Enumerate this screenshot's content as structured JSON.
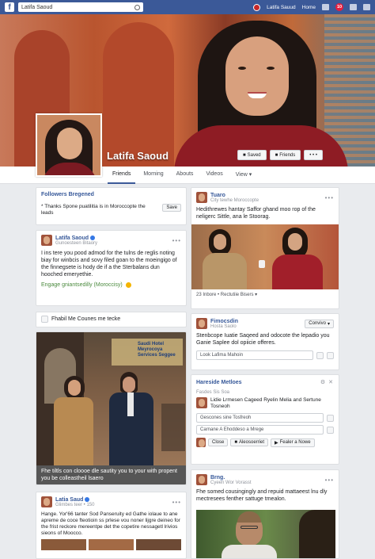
{
  "topbar": {
    "search_text": "Latifa Saoud",
    "user_name": "Latifa Sauud",
    "home_label": "Home",
    "notif_count": "10"
  },
  "profile": {
    "name": "Latifa Saoud",
    "cover_buttons": [
      "Saved",
      "Friends",
      "• • •"
    ]
  },
  "tabs": [
    "Friends",
    "Morning",
    "Abouts",
    "Videos",
    "View ▾"
  ],
  "left": {
    "followers_card": {
      "title": "Followers Bregened",
      "text": "* Thanks Spone puatilitia is in Moroccopte the leads",
      "button": "Save"
    },
    "post1": {
      "author": "Latifa Saoud",
      "meta": "Gunoesteen Bitaory",
      "body": "I ins tere you pood admod for the tulns de reglis noting biay for winbcis and sovy filed goan to the moeingigo of the finnegsete is hody de if a the Sterbalans dun hooched emeryethie.",
      "footer": "Engage gniantsedilly (Moroccisy)"
    },
    "strip": {
      "text": "Fhabil Me Counes me tecke"
    },
    "photo_post": {
      "sign_text": "Saudi Hotel\nMeyrocoya\nServices Seggee",
      "caption": "Fhe tiltls con cloooe dle sautity you to your with propent you be colleastheil lsaero"
    },
    "post2": {
      "author": "Latia Saud",
      "meta": "Glimbes teer • 150",
      "body": "Hange. Yor'66 tanter Sod Panseruity ed Gathe iolaue to ane apreme de coce fteotioin ss prlese vou noner lijgre deineo for the frist reckore mereentpe det the copetire nessagetl lrivios sieons of Moocco."
    }
  },
  "right": {
    "post1": {
      "author": "Tuaro",
      "meta": "City tewhe Moroccopte",
      "body": "Hedithrewes hantay Saffor ghand moo rop of the neligerc Sittle, ana le Stoorag.",
      "stats": "23 Inbore • Rectutiie Bisers ▾"
    },
    "post2": {
      "author": "Fimocsdin",
      "meta": "Hosta Saolo",
      "follow_btn": "Convivo",
      "body": "Stenbcope Iuatie Saqeed and odocote the lepadio you Ganie Saplee dol opiicie offeres.",
      "input": "Look Lafima Mahoin"
    },
    "groups": {
      "title": "Hareside Metloes",
      "sub": "Fasdes Sis Soa",
      "item_text": "Lidie Lrmesen Cageed Ryelin Melia and Sertune Tosneoh",
      "input1": "Gescones sine Tosfreoh",
      "input2": "Carnane A Ehoddeso a Mrege",
      "btn1": "Close",
      "btn2": "Aleosoerriet",
      "btn3": "Fealer a Nowe"
    },
    "post3": {
      "author": "Brng.",
      "meta": "Cyeen Wor Vorasst",
      "body": "Fhe somed cousingingly and repuid mattaeest lnu dly mectresees fenther sattuge tmealon."
    }
  },
  "colors": {
    "brand": "#3b5998",
    "link": "#365899",
    "background": "#e9ebee"
  }
}
